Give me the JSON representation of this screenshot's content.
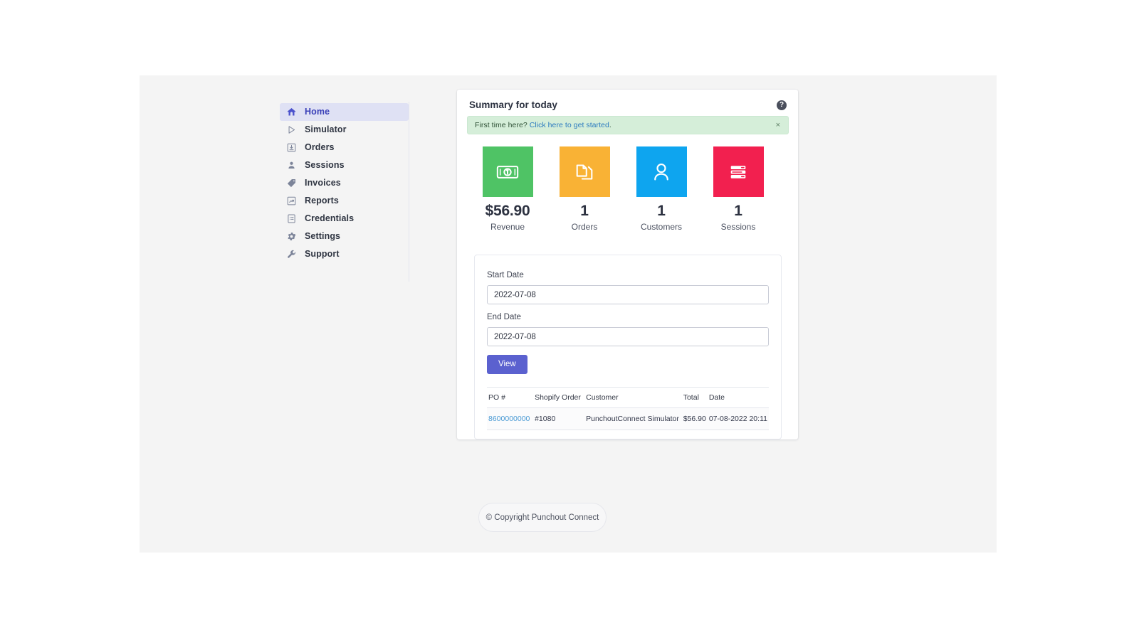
{
  "sidebar": {
    "items": [
      {
        "label": "Home",
        "icon": "home-icon",
        "active": true
      },
      {
        "label": "Simulator",
        "icon": "play-icon",
        "active": false
      },
      {
        "label": "Orders",
        "icon": "download-box-icon",
        "active": false
      },
      {
        "label": "Sessions",
        "icon": "person-icon",
        "active": false
      },
      {
        "label": "Invoices",
        "icon": "tag-icon",
        "active": false
      },
      {
        "label": "Reports",
        "icon": "report-chart-icon",
        "active": false
      },
      {
        "label": "Credentials",
        "icon": "credential-icon",
        "active": false
      },
      {
        "label": "Settings",
        "icon": "gear-icon",
        "active": false
      },
      {
        "label": "Support",
        "icon": "wrench-icon",
        "active": false
      }
    ]
  },
  "card": {
    "title": "Summary for today",
    "help_icon": "question-mark-icon"
  },
  "alert": {
    "prefix": "First time here? ",
    "link": "Click here to get started",
    "suffix": ".",
    "close_label": "×",
    "background_color": "#d5eed9",
    "link_color": "#2c7bbf"
  },
  "stats": [
    {
      "value": "$56.90",
      "label": "Revenue",
      "color": "#4fc365",
      "icon": "money-bill-icon"
    },
    {
      "value": "1",
      "label": "Orders",
      "color": "#f9b235",
      "icon": "documents-icon"
    },
    {
      "value": "1",
      "label": "Customers",
      "color": "#0ea5ef",
      "icon": "user-icon"
    },
    {
      "value": "1",
      "label": "Sessions",
      "color": "#f2204f",
      "icon": "server-list-icon"
    }
  ],
  "filter": {
    "start_label": "Start Date",
    "start_value": "2022-07-08",
    "start_placeholder": "YYYY-MM-DD",
    "end_label": "End Date",
    "end_value": "2022-07-08",
    "end_placeholder": "YYYY-MM-DD",
    "view_button": "View",
    "button_color": "#5b61cf"
  },
  "table": {
    "headers": [
      "PO #",
      "Shopify Order",
      "Customer",
      "Total",
      "Date"
    ],
    "rows": [
      {
        "po": "8600000000",
        "shopify_order": "#1080",
        "customer": "PunchoutConnect Simulator",
        "total": "$56.90",
        "date": "07-08-2022 20:11"
      }
    ]
  },
  "footer": {
    "text": "© Copyright Punchout Connect"
  }
}
